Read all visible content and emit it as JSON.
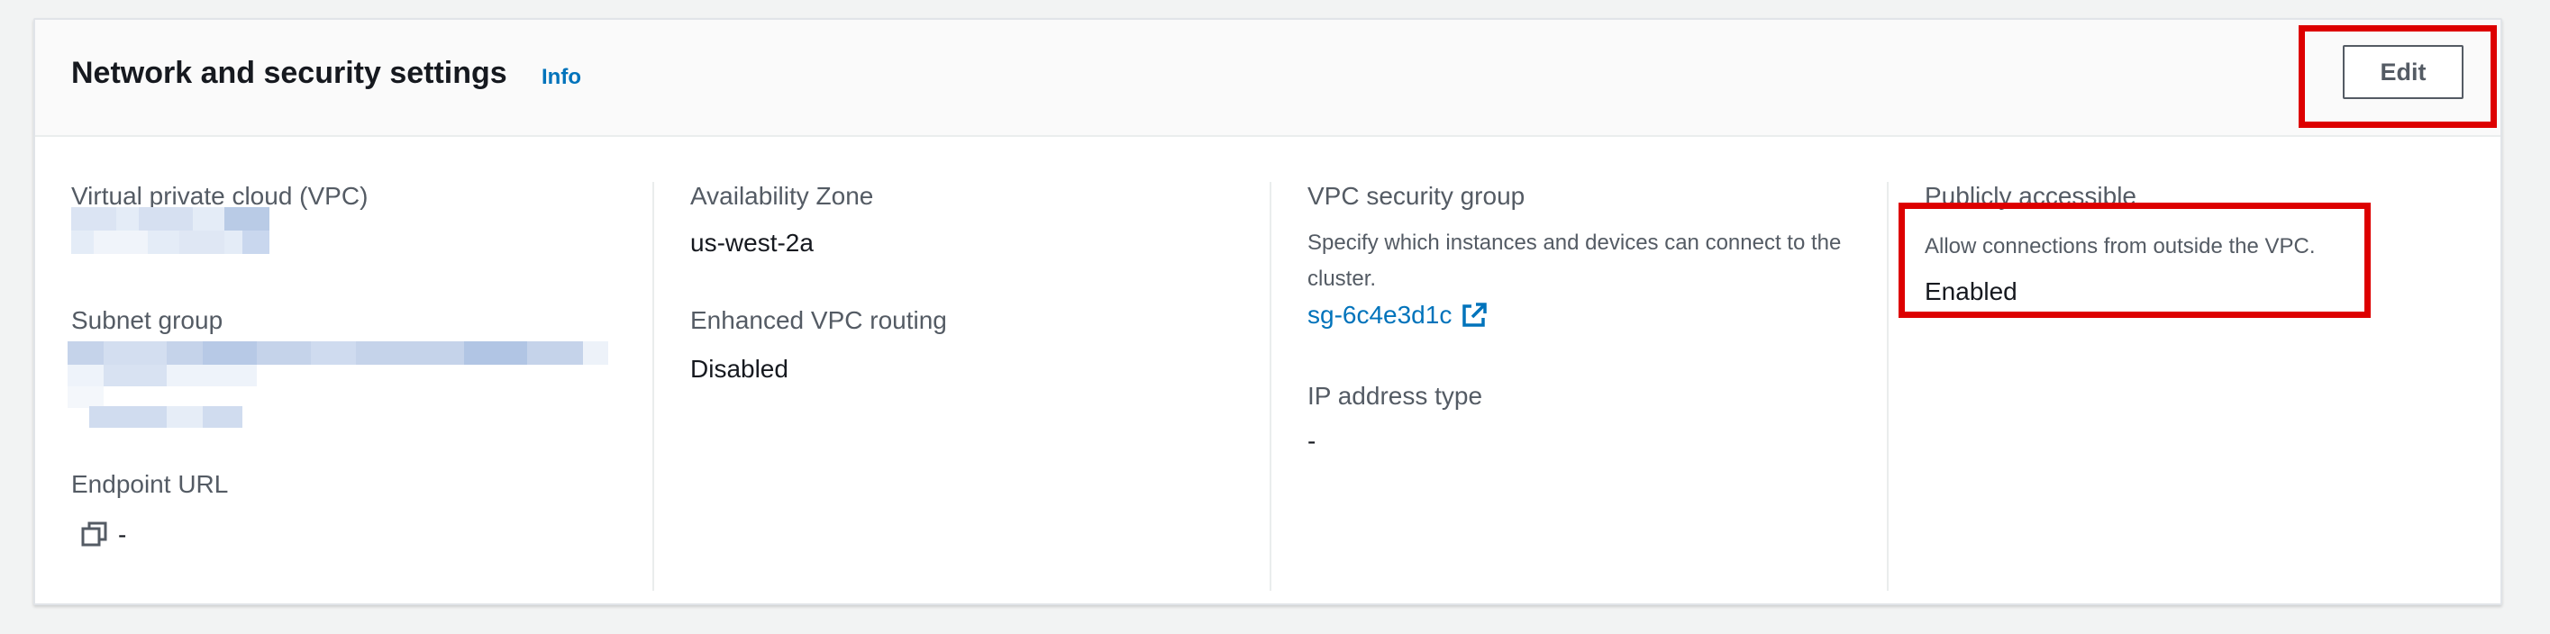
{
  "header": {
    "title": "Network and security settings",
    "info_label": "Info",
    "edit_label": "Edit"
  },
  "columns": {
    "vpc": {
      "label": "Virtual private cloud (VPC)",
      "value": ""
    },
    "subnet": {
      "label": "Subnet group",
      "value": ""
    },
    "endpoint": {
      "label": "Endpoint URL",
      "value": "-",
      "icon": "copy-icon"
    },
    "availability_zone": {
      "label": "Availability Zone",
      "value": "us-west-2a"
    },
    "enhanced_routing": {
      "label": "Enhanced VPC routing",
      "value": "Disabled"
    },
    "security_group": {
      "label": "VPC security group",
      "description": "Specify which instances and devices can connect to the cluster.",
      "link_text": "sg-6c4e3d1c",
      "icon": "external-link-icon"
    },
    "ip_type": {
      "label": "IP address type",
      "value": "-"
    },
    "public": {
      "label": "Publicly accessible",
      "description": "Allow connections from outside the VPC.",
      "value": "Enabled"
    }
  },
  "colors": {
    "link": "#0073bb",
    "highlight": "#dd0000",
    "redaction": "#c5d3ea"
  }
}
